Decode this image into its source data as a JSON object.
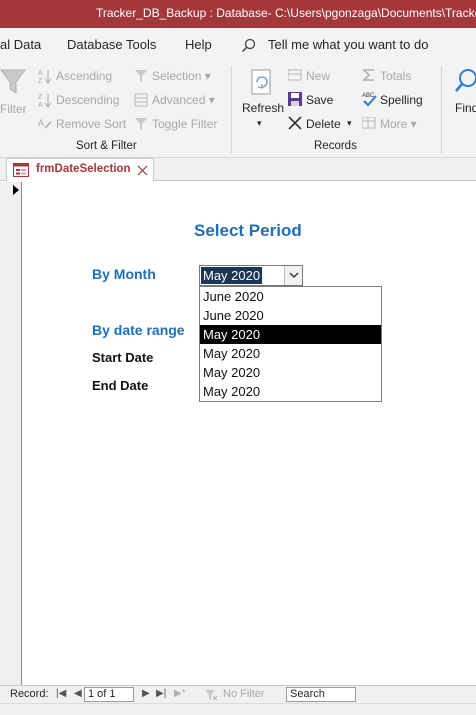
{
  "window": {
    "title": "Tracker_DB_Backup : Database- C:\\Users\\pgonzaga\\Documents\\Tracker_DB_Backup"
  },
  "menu": {
    "items": [
      "al Data",
      "Database Tools",
      "Help"
    ],
    "tell_me_placeholder": "Tell me what you want to do"
  },
  "ribbon": {
    "sort_filter": {
      "filter_label": "Filter",
      "ascending": "Ascending",
      "descending": "Descending",
      "remove_sort": "Remove Sort",
      "selection": "Selection",
      "advanced": "Advanced",
      "toggle_filter": "Toggle Filter",
      "group_label": "Sort & Filter"
    },
    "records": {
      "refresh": "Refresh",
      "new": "New",
      "save": "Save",
      "delete": "Delete",
      "totals": "Totals",
      "spelling": "Spelling",
      "more": "More",
      "group_label": "Records"
    },
    "find": {
      "label": "Find"
    }
  },
  "doc_tab": {
    "label": "frmDateSelection"
  },
  "form": {
    "title": "Select Period",
    "by_month_label": "By Month",
    "month_combo_value": "May 2020",
    "month_options": [
      "June 2020",
      "June 2020",
      "May 2020",
      "May 2020",
      "May 2020",
      "May 2020"
    ],
    "selected_option_index": 2,
    "by_date_range_label": "By date range",
    "start_date_label": "Start Date",
    "end_date_label": "End Date"
  },
  "status": {
    "record_label": "Record:",
    "record_position": "1 of 1",
    "no_filter": "No Filter",
    "search_placeholder": "Search"
  },
  "colors": {
    "titlebar": "#a4373a",
    "accent_blue": "#1f6fb2",
    "selected_item_bg": "#000000"
  }
}
